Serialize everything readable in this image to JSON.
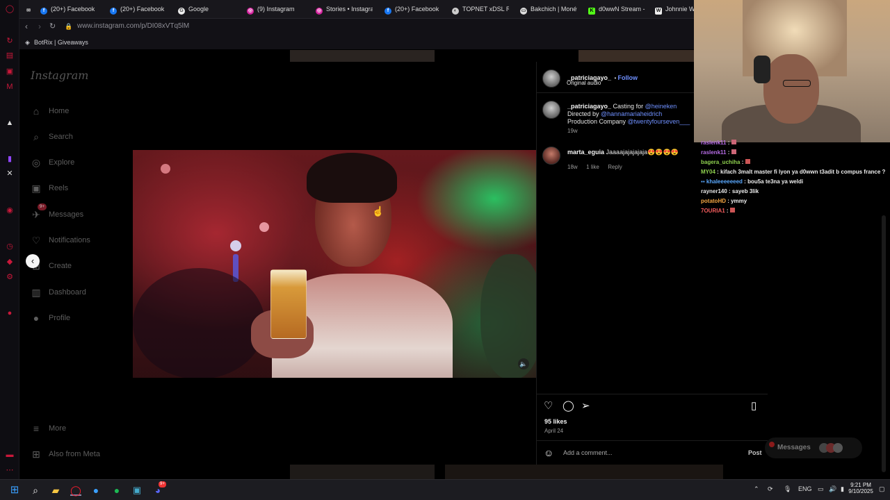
{
  "browser": {
    "tabs": [
      {
        "label": "",
        "icon": "mail-icon"
      },
      {
        "label": "(20+) Facebook",
        "icon": "facebook-icon"
      },
      {
        "label": "(20+) Facebook",
        "icon": "facebook-icon"
      },
      {
        "label": "Google",
        "icon": "google-icon"
      },
      {
        "label": "(9) Instagram",
        "icon": "instagram-icon"
      },
      {
        "label": "Stories • Instagra",
        "icon": "instagram-icon"
      },
      {
        "label": "(20+) Facebook",
        "icon": "facebook-icon"
      },
      {
        "label": "TOPNET xDSL RC",
        "icon": "globe-icon"
      },
      {
        "label": "Bakchich | Monét",
        "icon": "page-icon"
      },
      {
        "label": "d0wwN Stream -",
        "icon": "kick-icon"
      },
      {
        "label": "Johnnie W",
        "icon": "wikipedia-icon"
      }
    ],
    "url": "www.instagram.com/p/DI08xVTq5lM",
    "bookmark": "BotRix | Giveaways"
  },
  "sidebar": {
    "logo": "Instagram",
    "items": [
      {
        "label": "Home",
        "icon": "home-icon"
      },
      {
        "label": "Search",
        "icon": "search-icon"
      },
      {
        "label": "Explore",
        "icon": "compass-icon"
      },
      {
        "label": "Reels",
        "icon": "reels-icon"
      },
      {
        "label": "Messages",
        "icon": "messenger-icon",
        "badge": "9+"
      },
      {
        "label": "Notifications",
        "icon": "heart-icon"
      },
      {
        "label": "Create",
        "icon": "plus-icon"
      },
      {
        "label": "Dashboard",
        "icon": "dashboard-icon"
      },
      {
        "label": "Profile",
        "icon": "profile-icon"
      }
    ],
    "more": "More",
    "also_from_meta": "Also from Meta"
  },
  "post": {
    "author": "_patriciagayo_",
    "follow": "Follow",
    "audio": "Original audio",
    "caption": {
      "user": "_patriciagayo_",
      "line1_prefix": "Casting for ",
      "line1_link": "@heineken",
      "line2_prefix": "Directed by ",
      "line2_link": "@hannamariaheidrich",
      "line3_prefix": "Production Company ",
      "line3_link": "@twentyfourseven___",
      "time": "19w"
    },
    "comment": {
      "user": "marta_eguia",
      "text": "Jaaaajajajajaja😍😍😍😍",
      "time": "18w",
      "likes": "1 like",
      "reply": "Reply"
    },
    "likes": "95 likes",
    "date": "April 24",
    "add_comment_placeholder": "Add a comment...",
    "post_button": "Post"
  },
  "chat": [
    {
      "user": "raslenk11",
      "text": "",
      "color": "#b66ce5"
    },
    {
      "user": "raslenk11",
      "text": "",
      "color": "#b66ce5"
    },
    {
      "user": "bagera_uchiha",
      "text": "",
      "color": "#8fd14f"
    },
    {
      "user": "MY04",
      "text": "kifach 3malt master fi lyon ya d0wwn t3adit b compus france ?",
      "color": "#8fd14f"
    },
    {
      "user": "khaleeeeeeed",
      "text": "bou5a te3na ya weldi",
      "color": "#5aa9ff"
    },
    {
      "user": "rayner140",
      "text": "sayeb 3lik",
      "color": "#e6e6e6"
    },
    {
      "user": "potatoHD",
      "text": "ymmy",
      "color": "#f5a742"
    },
    {
      "user": "7OURIA1",
      "text": "",
      "color": "#f25c5c"
    }
  ],
  "messages_pill": "Messages",
  "taskbar": {
    "lang": "ENG",
    "time": "9:21 PM",
    "date": "9/10/2025",
    "discord_badge": "9+"
  }
}
